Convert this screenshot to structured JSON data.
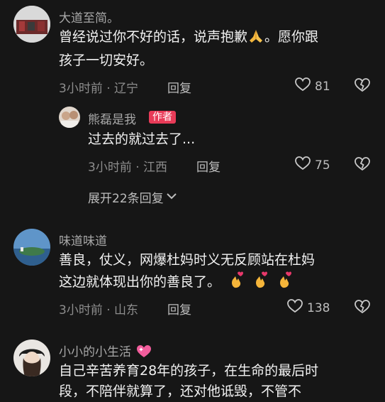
{
  "comments": [
    {
      "author": "大道至简。",
      "text_1": "曾经说过你不好的话，说声抱歉",
      "text_1b": "。愿你跟",
      "text_2": "孩子一切安好。",
      "time": "3小时前 · 辽宁",
      "reply_label": "回复",
      "likes": "81",
      "reply": {
        "author": "熊磊是我",
        "badge": "作者",
        "text": "过去的就过去了...",
        "time": "3小时前 · 江西",
        "reply_label": "回复",
        "likes": "75"
      },
      "expand_label": "展开22条回复"
    },
    {
      "author": "味道味道",
      "text_1": "善良，仗义，网爆杜妈时义无反顾站在杜妈",
      "text_2": "这边就体现出你的善良了。",
      "time": "3小时前 · 山东",
      "reply_label": "回复",
      "likes": "138"
    },
    {
      "author": "小小的小生活",
      "text_1": "自己辛苦养育28年的孩子，在生命的最后时",
      "text_2": "段，不陪伴就算了，还对他诋毁，不管不"
    }
  ],
  "icons": {
    "like": "heart-outline-icon",
    "dislike": "broken-heart-icon",
    "chevron": "chevron-down-icon",
    "praying": "praying-hands-emoji",
    "finger_heart": "finger-heart-emoji",
    "heart_emoji": "sparkling-heart-emoji"
  },
  "colors": {
    "background": "#161616",
    "author_badge": "#e83b58"
  }
}
